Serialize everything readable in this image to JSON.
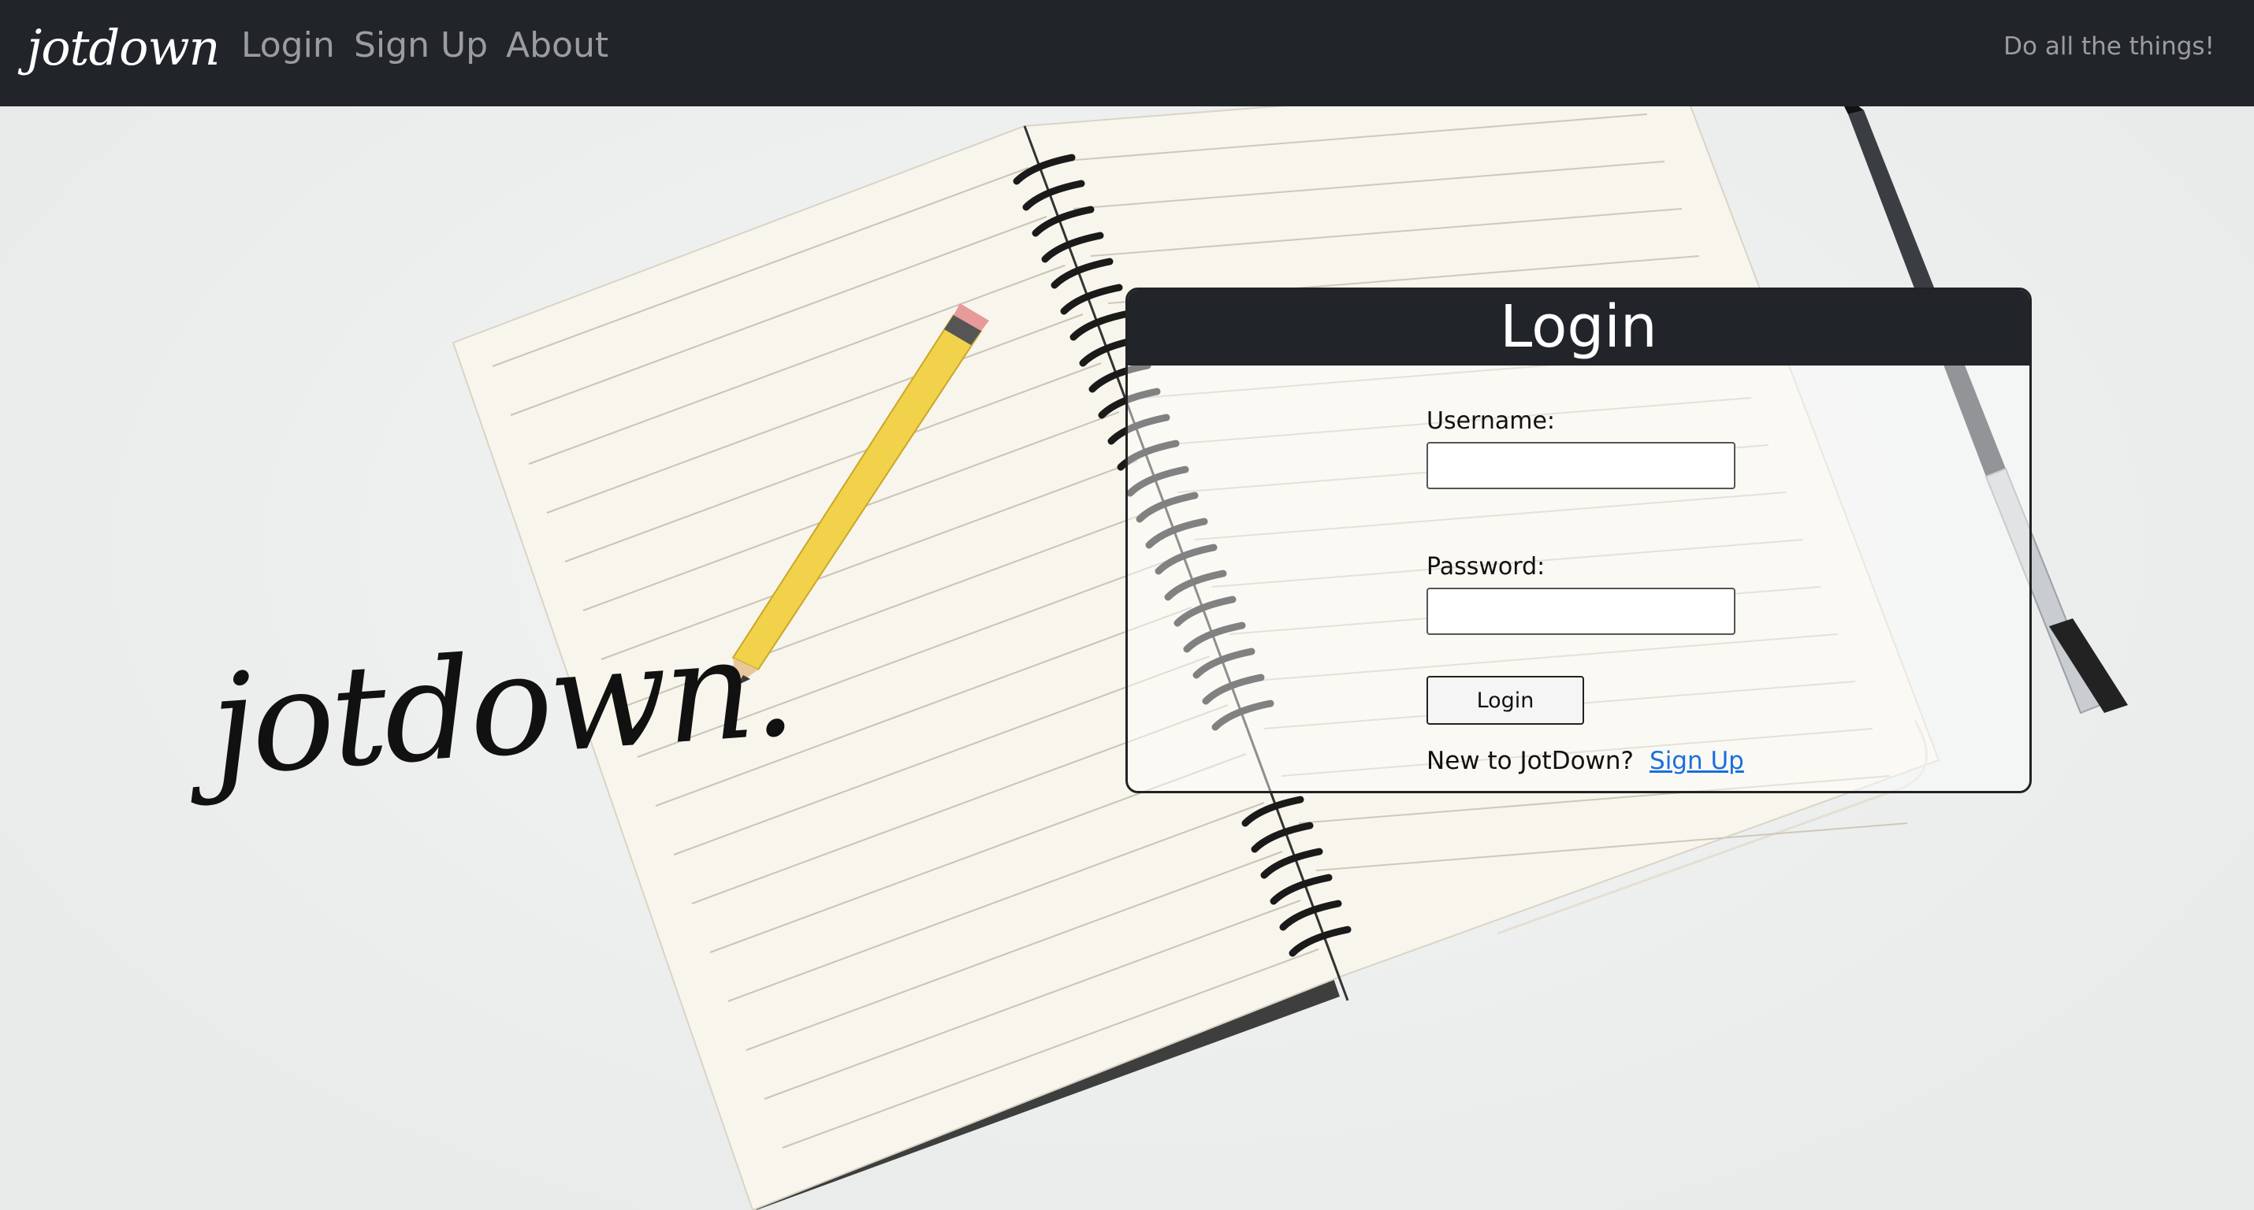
{
  "navbar": {
    "brand": "jotdown",
    "links": [
      "Login",
      "Sign Up",
      "About"
    ],
    "tagline": "Do all the things!"
  },
  "hero": {
    "logo_word": "jotdown."
  },
  "login_card": {
    "title": "Login",
    "username_label": "Username:",
    "username_value": "",
    "password_label": "Password:",
    "password_value": "",
    "submit_label": "Login",
    "new_user_text": "New to JotDown?",
    "signup_link": "Sign Up"
  },
  "colors": {
    "navbar_bg": "#212529",
    "nav_link": "#8f9296",
    "card_header_bg": "#212529",
    "link_blue": "#1a6fe0",
    "pencil_yellow": "#f2d24b",
    "paper": "#f8f5ec"
  }
}
